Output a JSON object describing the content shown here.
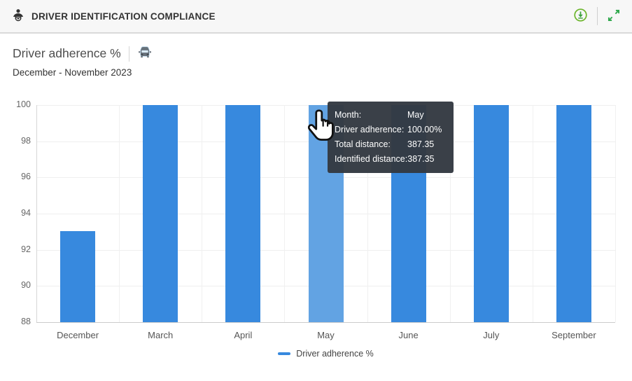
{
  "header": {
    "title": "DRIVER IDENTIFICATION COMPLIANCE"
  },
  "widget": {
    "title": "Driver adherence %",
    "subtitle": "December - November 2023"
  },
  "icons": {
    "header_left": "driver-icon",
    "title": "car-icon",
    "actions": [
      "download-icon",
      "expand-icon"
    ]
  },
  "tooltip": {
    "rows": [
      {
        "label": "Month:",
        "value": "May"
      },
      {
        "label": "Driver adherence:",
        "value": "100.00%"
      },
      {
        "label": "Total distance:",
        "value": "387.35"
      },
      {
        "label": "Identified distance:",
        "value": "387.35"
      }
    ]
  },
  "chart_data": {
    "type": "bar",
    "title": "Driver adherence %",
    "subtitle": "December - November 2023",
    "categories": [
      "December",
      "March",
      "April",
      "May",
      "June",
      "July",
      "September"
    ],
    "series": [
      {
        "name": "Driver adherence %",
        "values": [
          93.05,
          100,
          100,
          100,
          100,
          100,
          100
        ]
      }
    ],
    "highlighted_index": 3,
    "highlighted_category": "May",
    "ylim": [
      88,
      100
    ],
    "yticks": [
      88,
      90,
      92,
      94,
      96,
      98,
      100
    ],
    "grid": true,
    "legend": {
      "position": "bottom",
      "label": "Driver adherence %"
    },
    "colors": {
      "bar": "#3789DE",
      "bar_hover": "#62A3E3"
    }
  },
  "colors": {
    "icon_green_download": "#6CB52C",
    "icon_green_expand": "#2FA84C",
    "tooltip_bg": "#343A42",
    "header_bg": "#F7F7F7"
  }
}
